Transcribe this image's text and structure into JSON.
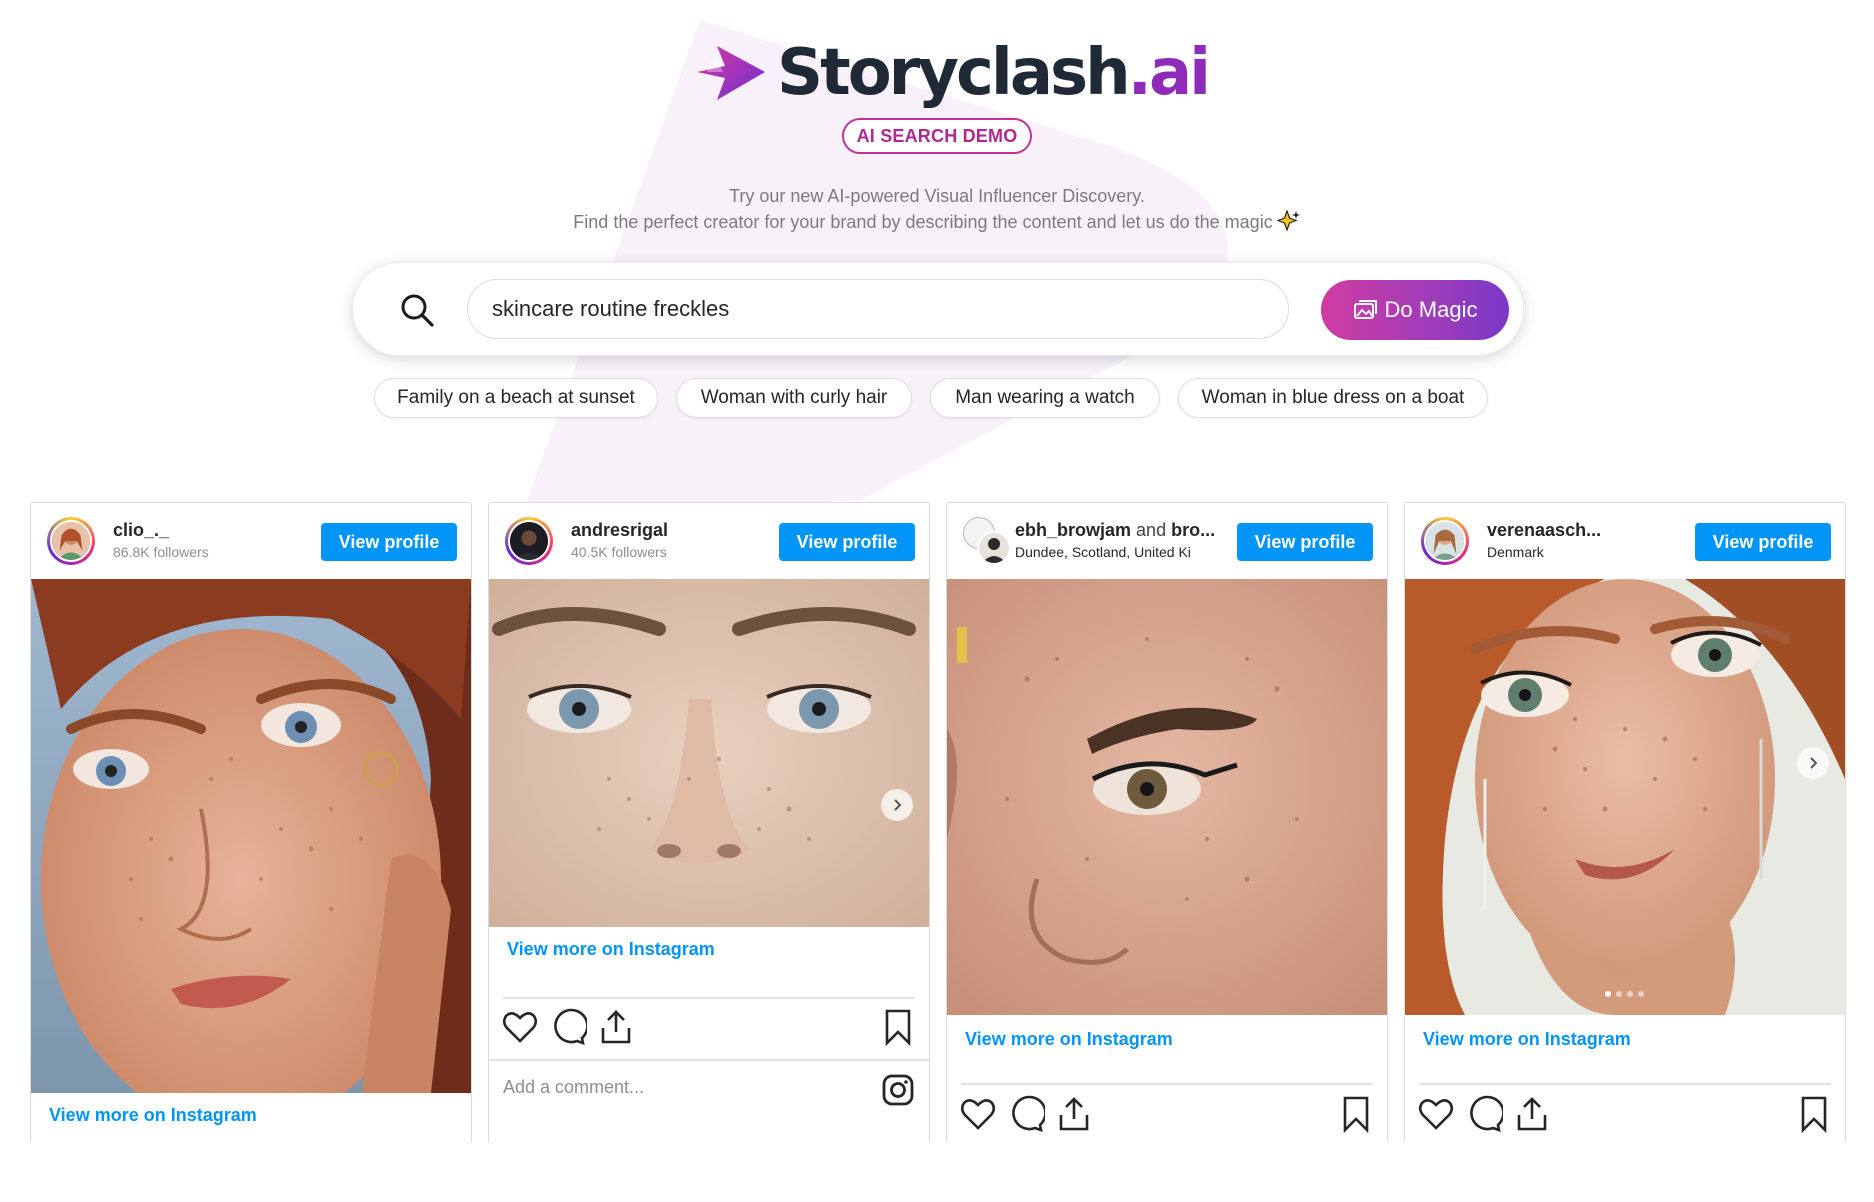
{
  "brand": {
    "name": "Storyclash",
    "suffix": ".ai",
    "badge": "AI SEARCH DEMO"
  },
  "tagline": {
    "line1": "Try our new AI-powered Visual Influencer Discovery.",
    "line2": "Find the perfect creator for your brand by describing the content and let us do the magic"
  },
  "search": {
    "value": "skincare routine freckles",
    "button_label": "Do Magic"
  },
  "suggestions": [
    "Family on a beach at sunset",
    "Woman with curly hair",
    "Man wearing a watch",
    "Woman in blue dress on a boat"
  ],
  "cards": [
    {
      "username": "clio_._",
      "subtitle": "86.8K followers",
      "view_profile": "View profile",
      "more_link": "View more on Instagram"
    },
    {
      "username": "andresrigal",
      "subtitle": "40.5K followers",
      "view_profile": "View profile",
      "more_link": "View more on Instagram",
      "comment_placeholder": "Add a comment..."
    },
    {
      "username": "ebh_browjam",
      "username_join": "and",
      "username_tail": "bro...",
      "subtitle": "Dundee, Scotland, United Ki",
      "view_profile": "View profile",
      "more_link": "View more on Instagram"
    },
    {
      "username": "verenaasch...",
      "subtitle": "Denmark",
      "view_profile": "View profile",
      "more_link": "View more on Instagram"
    }
  ],
  "colors": {
    "brand_dark": "#1f2a36",
    "brand_purple": "#8e2bb8",
    "badge_pink": "#c0319a",
    "instagram_blue": "#0095f6"
  },
  "icons": [
    "search-icon",
    "image-icon",
    "sparkle-icon",
    "heart-icon",
    "comment-icon",
    "share-icon",
    "bookmark-icon",
    "instagram-icon",
    "chevron-right-icon"
  ]
}
